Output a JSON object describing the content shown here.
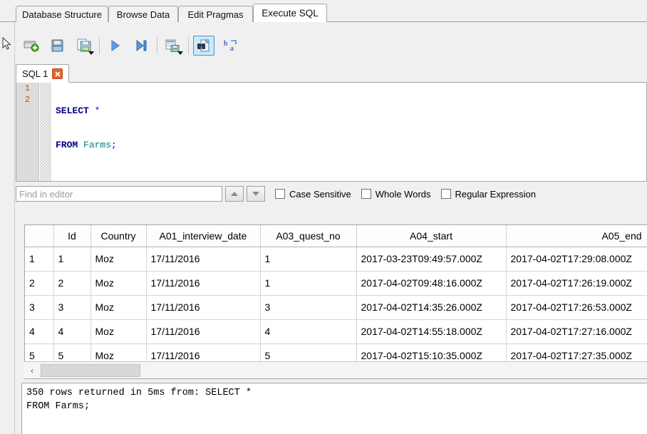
{
  "window": {
    "main_tabs": [
      {
        "label": "Database Structure",
        "active": false
      },
      {
        "label": "Browse Data",
        "active": false
      },
      {
        "label": "Edit Pragmas",
        "active": false
      },
      {
        "label": "Execute SQL",
        "active": true
      }
    ]
  },
  "toolbar": {
    "buttons": [
      {
        "name": "new-tab-icon",
        "tooltip": "Open tab"
      },
      {
        "name": "open-file-icon",
        "tooltip": "Open SQL file"
      },
      {
        "name": "save-file-icon",
        "tooltip": "Save SQL file",
        "has_dropdown": true
      },
      {
        "name": "execute-all-icon",
        "tooltip": "Execute all"
      },
      {
        "name": "execute-line-icon",
        "tooltip": "Execute current line"
      },
      {
        "name": "save-results-icon",
        "tooltip": "Save results",
        "has_dropdown": true
      },
      {
        "name": "find-icon",
        "tooltip": "Find",
        "active": true
      },
      {
        "name": "find-replace-icon",
        "tooltip": "Find and replace"
      }
    ],
    "active_highlight_color": "#cde8fa",
    "active_border_color": "#3c9ad6"
  },
  "sql_tab": {
    "label": "SQL 1",
    "close_label": "×",
    "close_color": "#e8642c"
  },
  "editor": {
    "line_numbers": [
      "1",
      "2"
    ],
    "lines": [
      {
        "keyword": "SELECT",
        "rest": " ",
        "operator": "*",
        "table": "",
        "punct": ""
      },
      {
        "keyword": "FROM",
        "rest": " ",
        "operator": "",
        "table": "Farms",
        "punct": ";"
      }
    ],
    "keyword_color": "#00008b",
    "table_color": "#008080",
    "operator_color": "#0000ff",
    "gutter_number_color": "#b06000"
  },
  "find_bar": {
    "placeholder": "Find in editor",
    "value": "",
    "prev_icon": "chevron-up-icon",
    "next_icon": "chevron-down-icon",
    "checkboxes": [
      {
        "label": "Case Sensitive",
        "checked": false
      },
      {
        "label": "Whole Words",
        "checked": false
      },
      {
        "label": "Regular Expression",
        "checked": false
      }
    ]
  },
  "results": {
    "columns": [
      "",
      "Id",
      "Country",
      "A01_interview_date",
      "A03_quest_no",
      "A04_start",
      "A05_end"
    ],
    "rows": [
      {
        "n": "1",
        "Id": "1",
        "Country": "Moz",
        "A01_interview_date": "17/11/2016",
        "A03_quest_no": "1",
        "A04_start": "2017-03-23T09:49:57.000Z",
        "A05_end": "2017-04-02T17:29:08.000Z"
      },
      {
        "n": "2",
        "Id": "2",
        "Country": "Moz",
        "A01_interview_date": "17/11/2016",
        "A03_quest_no": "1",
        "A04_start": "2017-04-02T09:48:16.000Z",
        "A05_end": "2017-04-02T17:26:19.000Z"
      },
      {
        "n": "3",
        "Id": "3",
        "Country": "Moz",
        "A01_interview_date": "17/11/2016",
        "A03_quest_no": "3",
        "A04_start": "2017-04-02T14:35:26.000Z",
        "A05_end": "2017-04-02T17:26:53.000Z"
      },
      {
        "n": "4",
        "Id": "4",
        "Country": "Moz",
        "A01_interview_date": "17/11/2016",
        "A03_quest_no": "4",
        "A04_start": "2017-04-02T14:55:18.000Z",
        "A05_end": "2017-04-02T17:27:16.000Z"
      },
      {
        "n": "5",
        "Id": "5",
        "Country": "Moz",
        "A01_interview_date": "17/11/2016",
        "A03_quest_no": "5",
        "A04_start": "2017-04-02T15:10:35.000Z",
        "A05_end": "2017-04-02T17:27:35.000Z"
      }
    ],
    "scrollbar": {
      "left_arrow": "‹"
    }
  },
  "status": {
    "message": "350 rows returned in 5ms from: SELECT *\nFROM Farms;"
  }
}
